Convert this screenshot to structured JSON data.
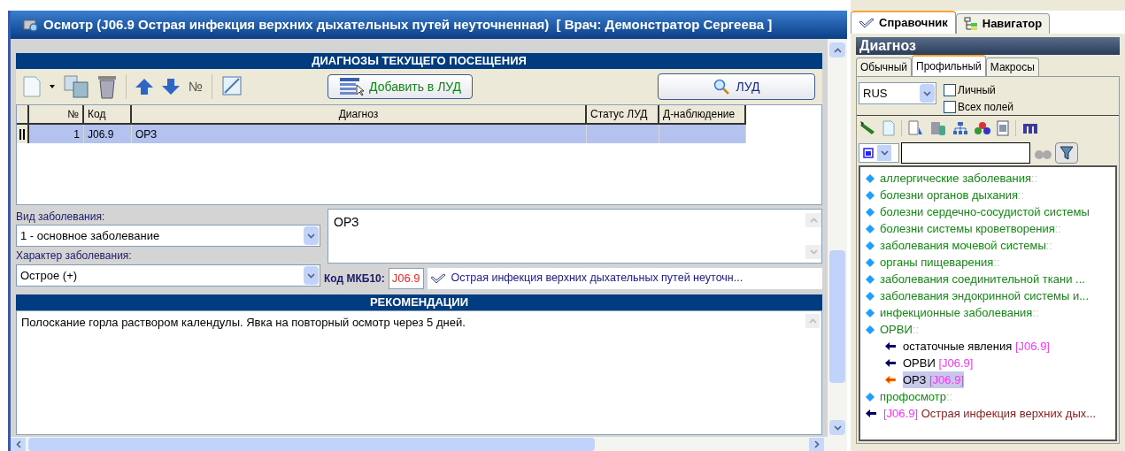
{
  "window": {
    "title": "Осмотр (J06.9 Острая инфекция верхних дыхательных путей неуточненная)  [ Врач: Демонстратор Сергеева ]"
  },
  "diagnoses": {
    "header": "ДИАГНОЗЫ ТЕКУЩЕГО ПОСЕЩЕНИЯ",
    "add_button": "Добавить в ЛУД",
    "lud_button": "ЛУД",
    "sort_icon": "№",
    "columns": [
      "№",
      "Код",
      "Диагноз",
      "Статус ЛУД",
      "Д-наблюдение"
    ],
    "rows": [
      {
        "cells": [
          "1",
          "J06.9",
          "ОРЗ",
          "",
          ""
        ],
        "selected": true
      }
    ]
  },
  "form": {
    "disease_type_label": "Вид заболевания:",
    "disease_type": "1 - основное заболевание",
    "character_label": "Характер заболевания:",
    "character": "Острое (+)",
    "note": "ОРЗ",
    "mkb_label": "Код МКБ10:",
    "mkb_code": "J06.9",
    "mkb_name": "Острая инфекция верхних дыхательных путей неуточн..."
  },
  "recommendations": {
    "header": "РЕКОМЕНДАЦИИ",
    "text": "Полоскание горла раствором календулы. Явка на повторный осмотр через 5 дней."
  },
  "side": {
    "tabs": [
      {
        "label": "Справочник",
        "selected": true
      },
      {
        "label": "Навигатор",
        "selected": false
      }
    ],
    "title": "Диагноз",
    "subtabs": [
      {
        "label": "Обычный",
        "selected": false
      },
      {
        "label": "Профильный",
        "selected": true
      },
      {
        "label": "Макросы",
        "selected": false
      }
    ],
    "language": "RUS",
    "personal": {
      "label": "Личный",
      "checked": false
    },
    "all_fields": {
      "label": "Всех полей",
      "checked": false
    },
    "tree": [
      {
        "kind": "category",
        "label": "аллергические заболевания",
        "suffix": "::",
        "selected": false
      },
      {
        "kind": "category",
        "label": "болезни органов дыхания",
        "suffix": "::",
        "selected": false
      },
      {
        "kind": "category",
        "label": "болезни сердечно-сосудистой системы",
        "selected": false
      },
      {
        "kind": "category",
        "label": "болезни системы кроветворения",
        "suffix": "::",
        "selected": false
      },
      {
        "kind": "category",
        "label": "заболевания мочевой системы",
        "suffix": "::",
        "selected": false
      },
      {
        "kind": "category",
        "label": "органы пищеварения",
        "suffix": "::",
        "selected": false
      },
      {
        "kind": "category",
        "label": "заболевания соединительной ткани ...",
        "selected": false
      },
      {
        "kind": "category",
        "label": "заболевания эндокринной системы и...",
        "selected": false
      },
      {
        "kind": "category",
        "label": "инфекционные заболевания",
        "suffix": "::",
        "selected": false
      },
      {
        "kind": "category",
        "label": "ОРВИ",
        "suffix": "::",
        "selected": false,
        "children": [
          {
            "kind": "entry",
            "label": "остаточные явления",
            "code": "[J06.9]",
            "selected": false
          },
          {
            "kind": "entry",
            "label": "ОРВИ",
            "code": "[J06.9]",
            "selected": false
          },
          {
            "kind": "entry",
            "label": "ОРЗ",
            "code": "[J06.9]",
            "selected": true
          }
        ]
      },
      {
        "kind": "category",
        "label": "профосмотр",
        "suffix": "::",
        "selected": false
      },
      {
        "kind": "code_first",
        "label": "Острая инфекция верхних дых...",
        "code": "[J06.9]",
        "selected": false
      }
    ]
  }
}
